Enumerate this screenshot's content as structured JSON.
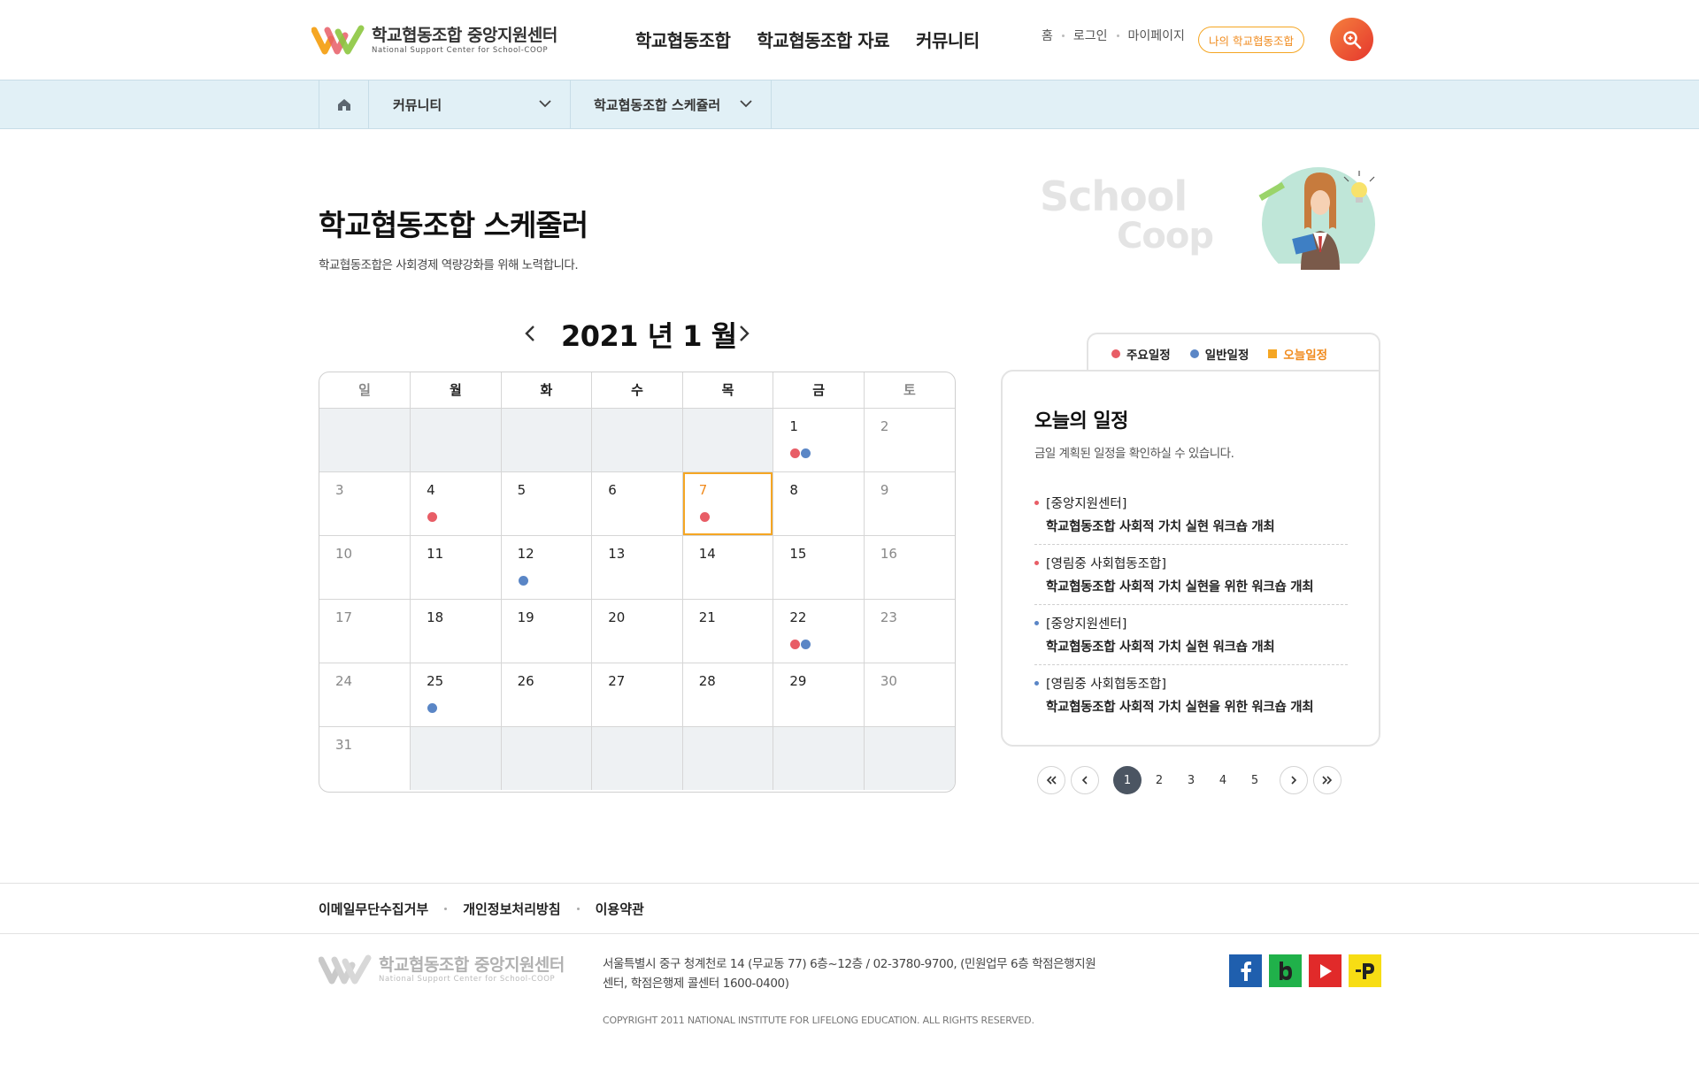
{
  "header": {
    "logo_ko": "학교협동조합 중앙지원센터",
    "logo_en": "National Support Center for School-COOP",
    "nav": [
      "학교협동조합",
      "학교협동조합 자료",
      "커뮤니티"
    ],
    "util": [
      "홈",
      "로그인",
      "마이페이지"
    ],
    "my_coop": "나의 학교협동조합",
    "search_icon": "search-icon"
  },
  "breadcrumb": {
    "level1": "커뮤니티",
    "level2": "학교협동조합 스케쥴러"
  },
  "page": {
    "title": "학교협동조합 스케줄러",
    "desc": "학교협동조합은 사회경제 역량강화를 위해 노력합니다.",
    "bg_word1": "School",
    "bg_word2": "Coop"
  },
  "calendar": {
    "month_label": "2021 년 1 월",
    "weekdays": [
      "일",
      "월",
      "화",
      "수",
      "목",
      "금",
      "토"
    ],
    "weeks": [
      [
        null,
        null,
        null,
        null,
        null,
        1,
        2
      ],
      [
        3,
        4,
        5,
        6,
        7,
        8,
        9
      ],
      [
        10,
        11,
        12,
        13,
        14,
        15,
        16
      ],
      [
        17,
        18,
        19,
        20,
        21,
        22,
        23
      ],
      [
        24,
        25,
        26,
        27,
        28,
        29,
        30
      ],
      [
        31,
        null,
        null,
        null,
        null,
        null,
        null
      ]
    ],
    "today": 7,
    "events": {
      "1": [
        "red",
        "blue"
      ],
      "4": [
        "red"
      ],
      "7": [
        "red"
      ],
      "12": [
        "blue"
      ],
      "22": [
        "red",
        "blue"
      ],
      "25": [
        "blue"
      ]
    },
    "colors": {
      "red": "#e85d66",
      "blue": "#5a86c6",
      "today": "#f5a623"
    }
  },
  "legend": {
    "major": "주요일정",
    "general": "일반일정",
    "today": "오늘일정"
  },
  "today_panel": {
    "title": "오늘의 일정",
    "desc": "금일 계획된 일정을 확인하실 수 있습니다.",
    "items": [
      {
        "type": "red",
        "org": "[중앙지원센터]",
        "title": "학교협동조합 사회적 가치 실현 워크숍 개최"
      },
      {
        "type": "red",
        "org": "[영림중 사회협동조합]",
        "title": "학교협동조합 사회적 가치 실현을 위한 워크숍 개최"
      },
      {
        "type": "blue",
        "org": "[중앙지원센터]",
        "title": "학교협동조합 사회적 가치 실현 워크숍 개최"
      },
      {
        "type": "blue",
        "org": "[영림중 사회협동조합]",
        "title": "학교협동조합 사회적 가치 실현을 위한 워크숍 개최"
      }
    ]
  },
  "pagination": {
    "pages": [
      "1",
      "2",
      "3",
      "4",
      "5"
    ],
    "current": "1"
  },
  "footer": {
    "links": [
      "이메일무단수집거부",
      "개인정보처리방침",
      "이용약관"
    ],
    "logo_ko": "학교협동조합 중앙지원센터",
    "logo_en": "National Support Center for School-COOP",
    "address": "서울특별시 중구 청계천로 14 (무교동 77) 6층~12층 / 02-3780-9700, (민원업무 6층 학점은행지원센터, 학점은행제 콜센터 1600-0400)",
    "copyright": "COPYRIGHT 2011 NATIONAL INSTITUTE FOR LIFELONG EDUCATION. ALL RIGHTS RESERVED.",
    "sns": [
      "facebook-icon",
      "blog-icon",
      "youtube-icon",
      "post-icon"
    ]
  }
}
